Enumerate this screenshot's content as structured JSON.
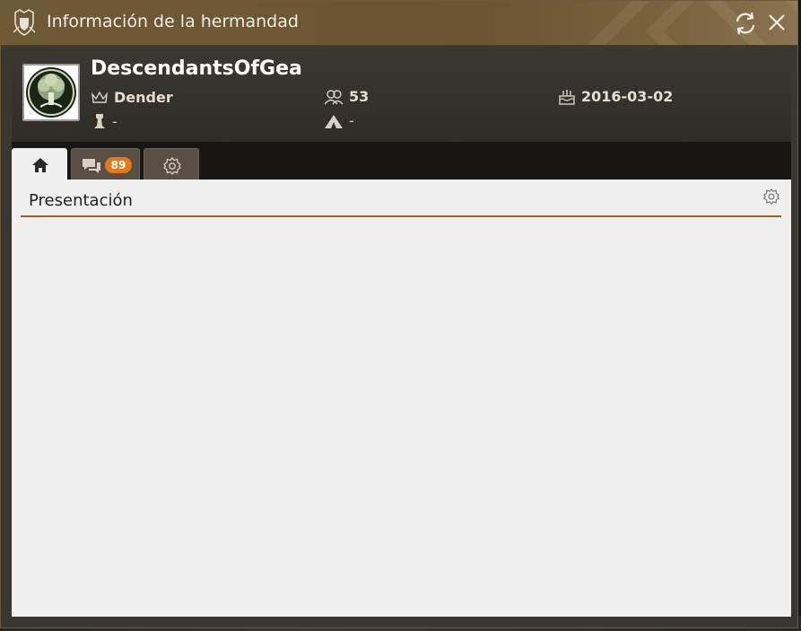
{
  "window": {
    "title": "Información de la hermandad"
  },
  "guild": {
    "name": "DescendantsOfGea",
    "leader": "Dender",
    "members": "53",
    "created": "2016-03-02",
    "rank": "-",
    "territory": "-"
  },
  "tabs": {
    "home_icon": "home-icon",
    "chat_badge": "89",
    "settings_icon": "gear-icon"
  },
  "content": {
    "section_title": "Presentación"
  },
  "colors": {
    "accent": "#e17a1b",
    "divider": "#a35d26",
    "titlebar": "#6e5a37"
  }
}
